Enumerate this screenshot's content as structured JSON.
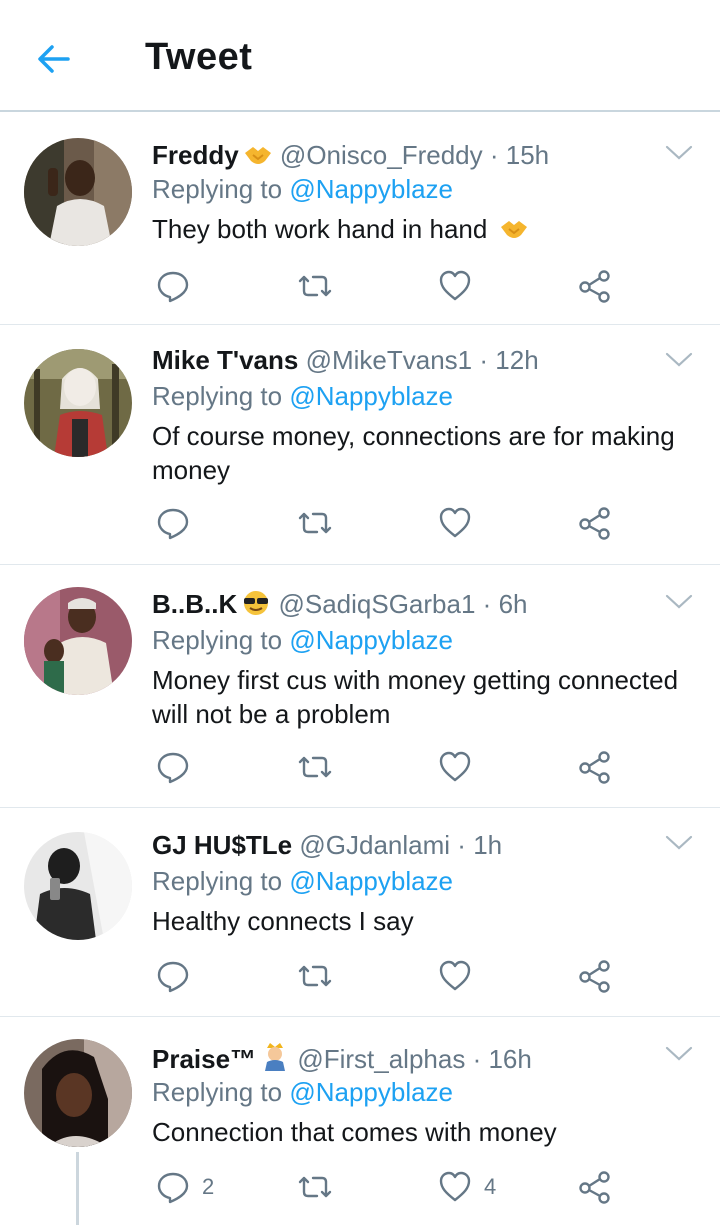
{
  "header": {
    "title": "Tweet"
  },
  "colors": {
    "accent": "#1da1f2",
    "muted": "#657786",
    "text": "#14171a",
    "divider": "#e1e8ed"
  },
  "tweets": [
    {
      "name": "Freddy",
      "name_emoji": "handshake",
      "handle": "@Onisco_Freddy",
      "dot": "·",
      "time": "15h",
      "reply_prefix": "Replying to",
      "reply_to": "@Nappyblaze",
      "text": "They both work hand in hand",
      "text_emoji": "handshake",
      "replies": "",
      "likes": "",
      "avatar": "avatar-freddy"
    },
    {
      "name": "Mike T'vans",
      "name_emoji": "",
      "handle": "@MikeTvans1",
      "dot": "·",
      "time": "12h",
      "reply_prefix": "Replying to",
      "reply_to": "@Nappyblaze",
      "text": "Of course money, connections are for making money",
      "replies": "",
      "likes": "",
      "avatar": "avatar-mike"
    },
    {
      "name": "B..B..K",
      "name_emoji": "sunglasses-face",
      "handle": "@SadiqSGarba1",
      "dot": "·",
      "time": "6h",
      "reply_prefix": "Replying to",
      "reply_to": "@Nappyblaze",
      "text": "Money first cus with money getting connected will not be a problem",
      "replies": "",
      "likes": "",
      "avatar": "avatar-bbk"
    },
    {
      "name": "GJ HU$TLe",
      "name_emoji": "",
      "handle": "@GJdanlami",
      "dot": "·",
      "time": "1h",
      "reply_prefix": "Replying to",
      "reply_to": "@Nappyblaze",
      "text": "Healthy connects I say",
      "replies": "",
      "likes": "",
      "avatar": "avatar-gj"
    },
    {
      "name": "Praise™",
      "name_emoji": "man-with-crown",
      "handle": "@First_alphas",
      "dot": "·",
      "time": "16h",
      "reply_prefix": "Replying to",
      "reply_to": "@Nappyblaze",
      "text": "Connection that comes with money",
      "replies": "2",
      "likes": "4",
      "avatar": "avatar-praise"
    }
  ]
}
